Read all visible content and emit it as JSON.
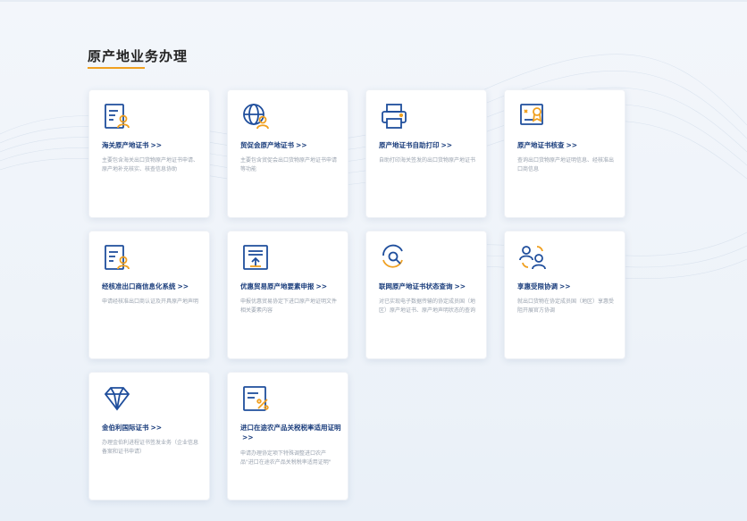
{
  "section": {
    "title": "原产地业务办理"
  },
  "colors": {
    "accent": "#f0a020",
    "title_blue": "#1a3d7c",
    "icon_blue": "#1f4e9c"
  },
  "cards": [
    {
      "title": "海关原产地证书",
      "arrow": ">>",
      "desc": "主要包含海关出口货物原产地证书申请、原产地补充核实、核查信息协助",
      "icon": "certificate-user-icon"
    },
    {
      "title": "贸促会原产地证书",
      "arrow": ">>",
      "desc": "主要包含贸促会出口货物原产地证书申请等功能",
      "icon": "globe-user-icon"
    },
    {
      "title": "原产地证书自助打印",
      "arrow": ">>",
      "desc": "自助打印海关签发的出口货物原产地证书",
      "icon": "printer-icon"
    },
    {
      "title": "原产地证书核查",
      "arrow": ">>",
      "desc": "查询出口货物原产地证明信息、经核准出口商信息",
      "icon": "certificate-ribbon-icon"
    },
    {
      "title": "经核准出口商信息化系统",
      "arrow": ">>",
      "desc": "申请经核准出口商认证及开具原产地声明",
      "icon": "document-user-icon"
    },
    {
      "title": "优惠贸易原产地要素申报",
      "arrow": ">>",
      "desc": "申报优惠贸易协定下进口原产地证明文件相关要素内容",
      "icon": "upload-document-icon"
    },
    {
      "title": "联网原产地证书状态查询",
      "arrow": ">>",
      "desc": "对已实现电子数据传输的协定成员国（地区）原产地证书、原产地声明状态的查询",
      "icon": "search-refresh-icon"
    },
    {
      "title": "享惠受限协调",
      "arrow": ">>",
      "desc": "就出口货物在协定成员国（地区）享惠受阻开展官方协调",
      "icon": "users-sync-icon"
    },
    {
      "title": "金伯利国际证书",
      "arrow": ">>",
      "desc": "办理金伯利进程证书签发业务（企业信息备案和证书申请）",
      "icon": "diamond-icon"
    },
    {
      "title": "进口在途农产品关税税率适用证明",
      "arrow": ">>",
      "desc": "申请办理协定项下特殊调整进口农产品\"进口在途农产品关税税率适用证明\"",
      "icon": "tariff-document-icon"
    }
  ]
}
